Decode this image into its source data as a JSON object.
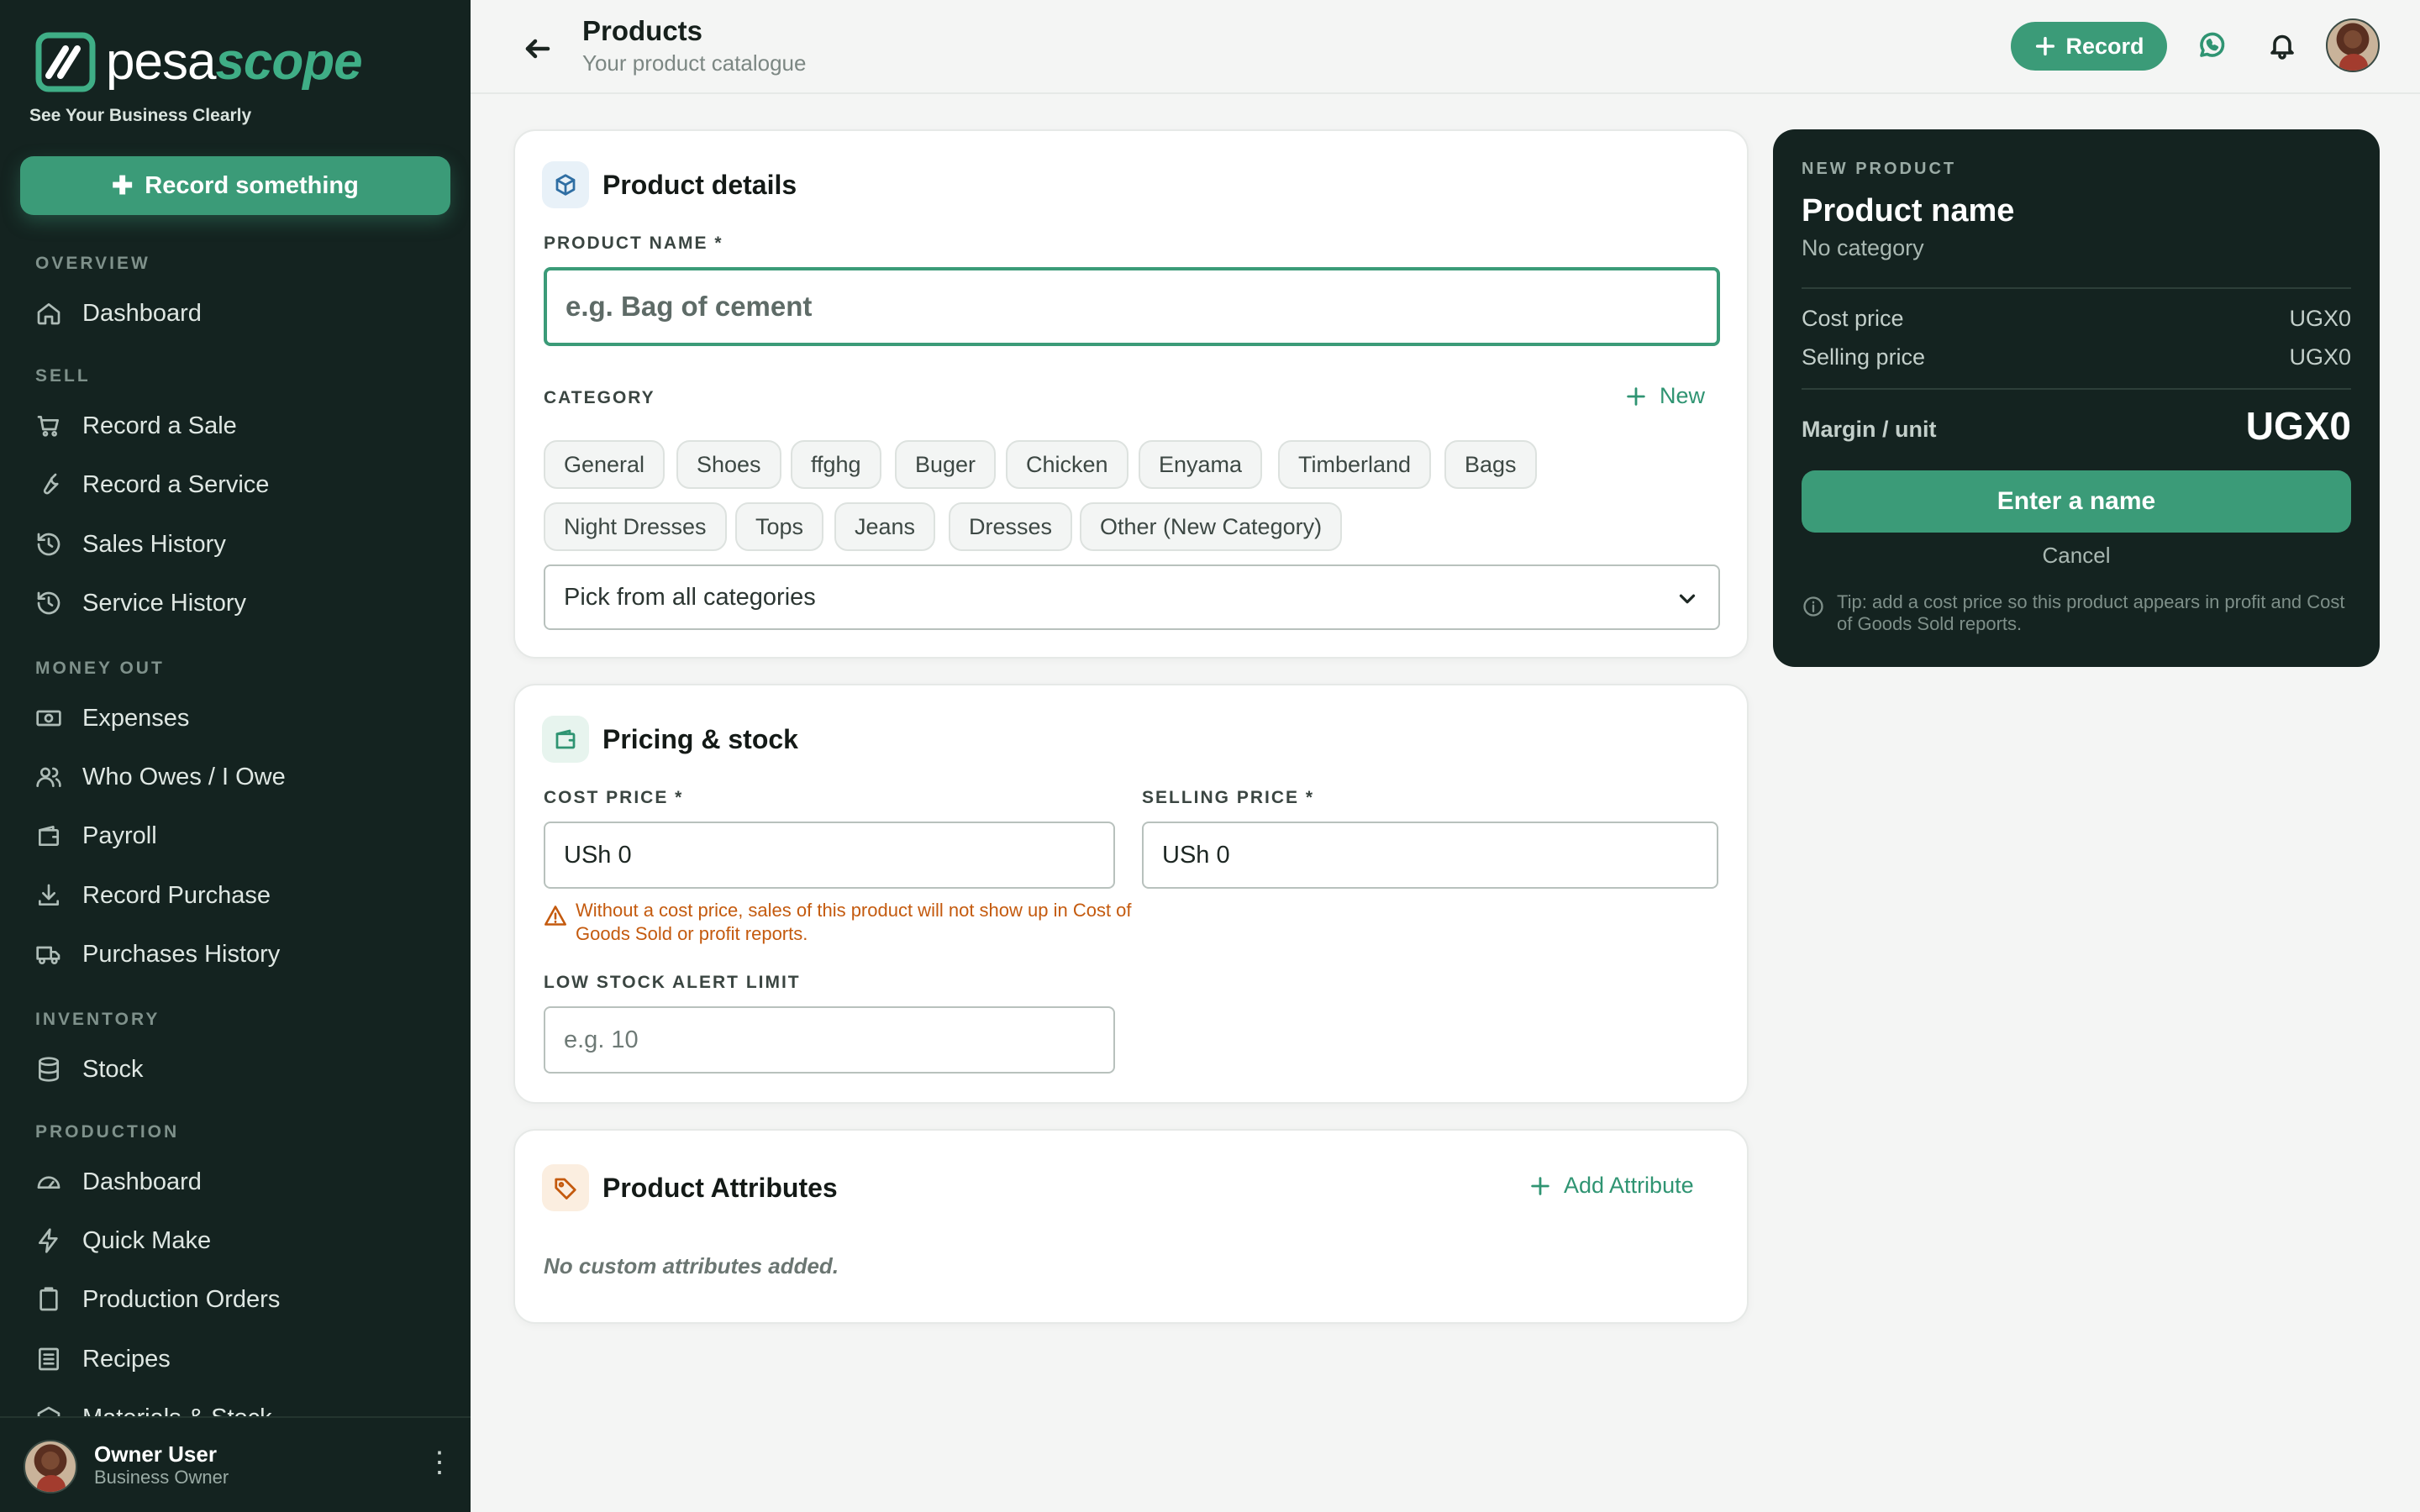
{
  "brand": {
    "name_part1": "pesa",
    "name_part2": "scope",
    "tagline": "See Your Business Clearly",
    "accent_color": "#3b9b78",
    "sidebar_bg": "#142320"
  },
  "sidebar": {
    "record_button": "Record something",
    "sections": [
      {
        "label": "OVERVIEW",
        "items": [
          {
            "label": "Dashboard",
            "icon": "home-icon"
          }
        ]
      },
      {
        "label": "SELL",
        "items": [
          {
            "label": "Record a Sale",
            "icon": "cart-icon"
          },
          {
            "label": "Record a Service",
            "icon": "wrench-icon"
          },
          {
            "label": "Sales History",
            "icon": "history-icon"
          },
          {
            "label": "Service History",
            "icon": "history-icon"
          }
        ]
      },
      {
        "label": "MONEY OUT",
        "items": [
          {
            "label": "Expenses",
            "icon": "cash-icon"
          },
          {
            "label": "Who Owes / I Owe",
            "icon": "users-icon"
          },
          {
            "label": "Payroll",
            "icon": "wallet-icon"
          },
          {
            "label": "Record Purchase",
            "icon": "download-icon"
          },
          {
            "label": "Purchases History",
            "icon": "truck-icon"
          }
        ]
      },
      {
        "label": "INVENTORY",
        "items": [
          {
            "label": "Stock",
            "icon": "database-icon"
          }
        ]
      },
      {
        "label": "PRODUCTION",
        "items": [
          {
            "label": "Dashboard",
            "icon": "gauge-icon"
          },
          {
            "label": "Quick Make",
            "icon": "bolt-icon"
          },
          {
            "label": "Production Orders",
            "icon": "clipboard-icon"
          },
          {
            "label": "Recipes",
            "icon": "list-icon"
          },
          {
            "label": "Materials & Stock",
            "icon": "box-icon"
          }
        ]
      }
    ],
    "user": {
      "name": "Owner User",
      "role": "Business Owner"
    }
  },
  "header": {
    "title": "Products",
    "subtitle": "Your product catalogue",
    "record_button": "Record"
  },
  "product_details": {
    "title": "Product details",
    "name_label": "PRODUCT NAME *",
    "name_placeholder": "e.g. Bag of cement",
    "category_label": "CATEGORY",
    "new_button": "New",
    "categories": [
      "General",
      "Shoes",
      "ffghg",
      "Buger",
      "Chicken",
      "Enyama",
      "Timberland",
      "Bags",
      "Night Dresses",
      "Tops",
      "Jeans",
      "Dresses",
      "Other (New Category)"
    ],
    "select_placeholder": "Pick from all categories"
  },
  "pricing": {
    "title": "Pricing & stock",
    "cost_label": "COST PRICE *",
    "cost_value": "USh 0",
    "selling_label": "SELLING PRICE *",
    "selling_value": "USh 0",
    "warning": "Without a cost price, sales of this product will not show up in Cost of Goods Sold or profit reports.",
    "low_stock_label": "LOW STOCK ALERT LIMIT",
    "low_stock_placeholder": "e.g. 10"
  },
  "attributes": {
    "title": "Product Attributes",
    "add_button": "Add Attribute",
    "empty_text": "No custom attributes added."
  },
  "preview": {
    "eyebrow": "NEW PRODUCT",
    "name": "Product name",
    "category": "No category",
    "cost_label": "Cost price",
    "cost_value": "UGX0",
    "selling_label": "Selling price",
    "selling_value": "UGX0",
    "margin_label": "Margin / unit",
    "margin_value": "UGX0",
    "submit_button": "Enter a name",
    "cancel": "Cancel",
    "tip": "Tip: add a cost price so this product appears in profit and Cost of Goods Sold reports."
  }
}
